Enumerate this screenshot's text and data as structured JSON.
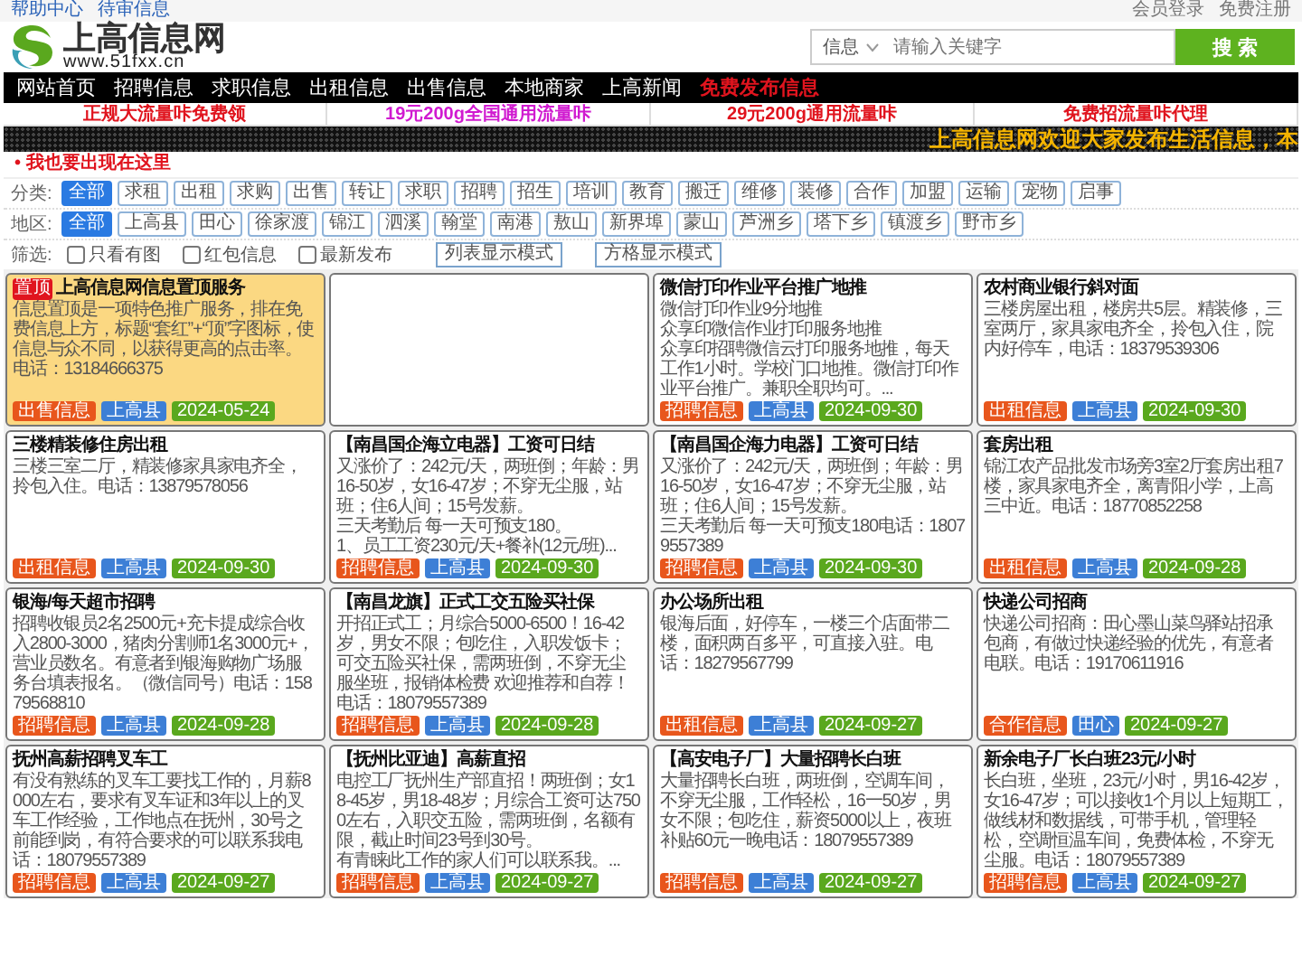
{
  "top_bar": {
    "left_links": [
      "帮助中心",
      "待审信息"
    ],
    "right_links": [
      "会员登录",
      "免费注册"
    ]
  },
  "logo": {
    "name": "上高信息网",
    "url": "www.51fxx.cn"
  },
  "search": {
    "scope": "信息",
    "placeholder": "请输入关键字",
    "button": "搜 索"
  },
  "nav": [
    {
      "label": "网站首页",
      "highlight": false
    },
    {
      "label": "招聘信息",
      "highlight": false
    },
    {
      "label": "求职信息",
      "highlight": false
    },
    {
      "label": "出租信息",
      "highlight": false
    },
    {
      "label": "出售信息",
      "highlight": false
    },
    {
      "label": "本地商家",
      "highlight": false
    },
    {
      "label": "上高新闻",
      "highlight": false
    },
    {
      "label": "免费发布信息",
      "highlight": true
    }
  ],
  "promo_links": [
    {
      "text": "正规大流量咔免费领",
      "color": "#e0141e"
    },
    {
      "text": "19元200g全国通用流量咔",
      "color": "#d01ad0"
    },
    {
      "text": "29元200g通用流量咔",
      "color": "#e0141e"
    },
    {
      "text": "免费招流量咔代理",
      "color": "#e0141e"
    }
  ],
  "marquee": "上高信息网欢迎大家发布生活信息，本",
  "notice": "• 我也要出现在这里",
  "filters": [
    {
      "label": "分类:",
      "chips": [
        {
          "text": "全部",
          "selected": true
        },
        {
          "text": "求租",
          "selected": false
        },
        {
          "text": "出租",
          "selected": false
        },
        {
          "text": "求购",
          "selected": false
        },
        {
          "text": "出售",
          "selected": false
        },
        {
          "text": "转让",
          "selected": false
        },
        {
          "text": "求职",
          "selected": false
        },
        {
          "text": "招聘",
          "selected": false
        },
        {
          "text": "招生",
          "selected": false
        },
        {
          "text": "培训",
          "selected": false
        },
        {
          "text": "教育",
          "selected": false
        },
        {
          "text": "搬迁",
          "selected": false
        },
        {
          "text": "维修",
          "selected": false
        },
        {
          "text": "装修",
          "selected": false
        },
        {
          "text": "合作",
          "selected": false
        },
        {
          "text": "加盟",
          "selected": false
        },
        {
          "text": "运输",
          "selected": false
        },
        {
          "text": "宠物",
          "selected": false
        },
        {
          "text": "启事",
          "selected": false
        }
      ]
    },
    {
      "label": "地区:",
      "chips": [
        {
          "text": "全部",
          "selected": true
        },
        {
          "text": "上高县",
          "selected": false
        },
        {
          "text": "田心",
          "selected": false
        },
        {
          "text": "徐家渡",
          "selected": false
        },
        {
          "text": "锦江",
          "selected": false
        },
        {
          "text": "泗溪",
          "selected": false
        },
        {
          "text": "翰堂",
          "selected": false
        },
        {
          "text": "南港",
          "selected": false
        },
        {
          "text": "敖山",
          "selected": false
        },
        {
          "text": "新界埠",
          "selected": false
        },
        {
          "text": "蒙山",
          "selected": false
        },
        {
          "text": "芦洲乡",
          "selected": false
        },
        {
          "text": "塔下乡",
          "selected": false
        },
        {
          "text": "镇渡乡",
          "selected": false
        },
        {
          "text": "野市乡",
          "selected": false
        }
      ]
    }
  ],
  "options": {
    "label": "筛选:",
    "checkboxes": [
      {
        "label": "只看有图",
        "checked": false
      },
      {
        "label": "红包信息",
        "checked": false
      },
      {
        "label": "最新发布",
        "checked": false
      }
    ],
    "view_buttons": [
      "列表显示模式",
      "方格显示模式"
    ]
  },
  "cards": [
    {
      "kind": "pinned",
      "badge": "置顶",
      "title": "上高信息网信息置顶服务",
      "body": [
        "信息置顶是一项特色推广服务，排在免费信息上方，标题“套红”+“顶”字图标，使信息与众不同，以获得更高的点击率。电话：13184666375"
      ],
      "tags": [
        {
          "kind": "category",
          "text": "出售信息"
        },
        {
          "kind": "area",
          "text": "上高县"
        },
        {
          "kind": "date",
          "text": "2024-05-24"
        }
      ]
    },
    {
      "kind": "empty"
    },
    {
      "kind": "normal",
      "title": "微信打印作业平台推广地推",
      "body": [
        "微信打印作业9分地推",
        "众享印微信作业打印服务地推",
        "众享印招聘微信云打印服务地推，每天工作1小时。学校门口地推。微信打印作业平台推广。兼职全职均可。..."
      ],
      "tags": [
        {
          "kind": "category",
          "text": "招聘信息"
        },
        {
          "kind": "area",
          "text": "上高县"
        },
        {
          "kind": "date",
          "text": "2024-09-30"
        }
      ]
    },
    {
      "kind": "normal",
      "title": "农村商业银行斜对面",
      "body": [
        "三楼房屋出租，楼房共5层。精装修，三室两厅，家具家电齐全，拎包入住，院内好停车，电话：18379539306"
      ],
      "tags": [
        {
          "kind": "category",
          "text": "出租信息"
        },
        {
          "kind": "area",
          "text": "上高县"
        },
        {
          "kind": "date",
          "text": "2024-09-30"
        }
      ]
    },
    {
      "kind": "normal",
      "title": "三楼精装修住房出租",
      "body": [
        "三楼三室二厅，精装修家具家电齐全，拎包入住。电话：13879578056"
      ],
      "tags": [
        {
          "kind": "category",
          "text": "出租信息"
        },
        {
          "kind": "area",
          "text": "上高县"
        },
        {
          "kind": "date",
          "text": "2024-09-30"
        }
      ]
    },
    {
      "kind": "normal",
      "title": "【南昌国企海立电器】工资可日结",
      "body": [
        "又涨价了：242元/天，两班倒；年龄：男16-50岁，女16-47岁；不穿无尘服，站班；住6人间；15号发薪。",
        "三天考勤后 每一天可预支180。",
        "1、员工工资230元/天+餐补(12元/班)..."
      ],
      "tags": [
        {
          "kind": "category",
          "text": "招聘信息"
        },
        {
          "kind": "area",
          "text": "上高县"
        },
        {
          "kind": "date",
          "text": "2024-09-30"
        }
      ]
    },
    {
      "kind": "normal",
      "title": "【南昌国企海力电器】工资可日结",
      "body": [
        "又涨价了：242元/天，两班倒；年龄：男16-50岁，女16-47岁；不穿无尘服，站班；住6人间；15号发薪。",
        "三天考勤后 每一天可预支180电话：18079557389"
      ],
      "tags": [
        {
          "kind": "category",
          "text": "招聘信息"
        },
        {
          "kind": "area",
          "text": "上高县"
        },
        {
          "kind": "date",
          "text": "2024-09-30"
        }
      ]
    },
    {
      "kind": "normal",
      "title": "套房出租",
      "body": [
        "锦江农产品批发市场旁3室2厅套房出租7楼，家具家电齐全，离青阳小学，上高三中近。电话：18770852258"
      ],
      "tags": [
        {
          "kind": "category",
          "text": "出租信息"
        },
        {
          "kind": "area",
          "text": "上高县"
        },
        {
          "kind": "date",
          "text": "2024-09-28"
        }
      ]
    },
    {
      "kind": "normal",
      "title": "银海/每天超市招聘",
      "body": [
        "招聘收银员2名2500元+充卡提成综合收入2800-3000，猪肉分割师1名3000元+，营业员数名。有意者到银海购物广场服务台填表报名。（微信同号）电话：15879568810"
      ],
      "tags": [
        {
          "kind": "category",
          "text": "招聘信息"
        },
        {
          "kind": "area",
          "text": "上高县"
        },
        {
          "kind": "date",
          "text": "2024-09-28"
        }
      ]
    },
    {
      "kind": "normal",
      "title": "【南昌龙旗】正式工交五险买社保",
      "body": [
        "开招正式工；月综合5000-6500！16-42岁，男女不限；包吃住，入职发饭卡；可交五险买社保，需两班倒，不穿无尘服坐班，报销体检费 欢迎推荐和自荐！电话：18079557389"
      ],
      "tags": [
        {
          "kind": "category",
          "text": "招聘信息"
        },
        {
          "kind": "area",
          "text": "上高县"
        },
        {
          "kind": "date",
          "text": "2024-09-28"
        }
      ]
    },
    {
      "kind": "normal",
      "title": "办公场所出租",
      "body": [
        "银海后面，好停车，一楼三个店面带二楼，面积两百多平，可直接入驻。电话：18279567799"
      ],
      "tags": [
        {
          "kind": "category",
          "text": "出租信息"
        },
        {
          "kind": "area",
          "text": "上高县"
        },
        {
          "kind": "date",
          "text": "2024-09-27"
        }
      ]
    },
    {
      "kind": "normal",
      "title": "快递公司招商",
      "body": [
        "快递公司招商：田心墨山菜鸟驿站招承包商，有做过快递经验的优先，有意者电联。电话：19170611916"
      ],
      "tags": [
        {
          "kind": "category",
          "text": "合作信息"
        },
        {
          "kind": "area",
          "text": "田心"
        },
        {
          "kind": "date",
          "text": "2024-09-27"
        }
      ]
    },
    {
      "kind": "normal",
      "title": "抚州高薪招聘叉车工",
      "body": [
        "有没有熟练的叉车工要找工作的，月薪8000左右，要求有叉车证和3年以上的叉车工作经验，工作地点在抚州，30号之前能到岗，有符合要求的可以联系我电话：18079557389"
      ],
      "tags": [
        {
          "kind": "category",
          "text": "招聘信息"
        },
        {
          "kind": "area",
          "text": "上高县"
        },
        {
          "kind": "date",
          "text": "2024-09-27"
        }
      ]
    },
    {
      "kind": "normal",
      "title": "【抚州比亚迪】高薪直招",
      "body": [
        "电控工厂抚州生产部直招！两班倒；女18-45岁，男18-48岁；月综合工资可达7500左右，入职交五险，需两班倒，名额有限，截止时间23号到30号。",
        "有青睐此工作的家人们可以联系我。..."
      ],
      "tags": [
        {
          "kind": "category",
          "text": "招聘信息"
        },
        {
          "kind": "area",
          "text": "上高县"
        },
        {
          "kind": "date",
          "text": "2024-09-27"
        }
      ]
    },
    {
      "kind": "normal",
      "title": "【高安电子厂】大量招聘长白班",
      "body": [
        "大量招聘长白班，两班倒，空调车间，不穿无尘服，工作轻松，16一50岁，男女不限；包吃住，薪资5000以上，夜班补贴60元一晚电话：18079557389"
      ],
      "tags": [
        {
          "kind": "category",
          "text": "招聘信息"
        },
        {
          "kind": "area",
          "text": "上高县"
        },
        {
          "kind": "date",
          "text": "2024-09-27"
        }
      ]
    },
    {
      "kind": "normal",
      "title": "新余电子厂长白班23元/小时",
      "body": [
        "长白班，坐班，23元/小时，男16-42岁，女16-47岁；可以接收1个月以上短期工，做线材和数据线，可带手机，管理轻松，空调恒温车间，免费体检，不穿无尘服。电话：18079557389"
      ],
      "tags": [
        {
          "kind": "category",
          "text": "招聘信息"
        },
        {
          "kind": "area",
          "text": "上高县"
        },
        {
          "kind": "date",
          "text": "2024-09-27"
        }
      ]
    }
  ]
}
